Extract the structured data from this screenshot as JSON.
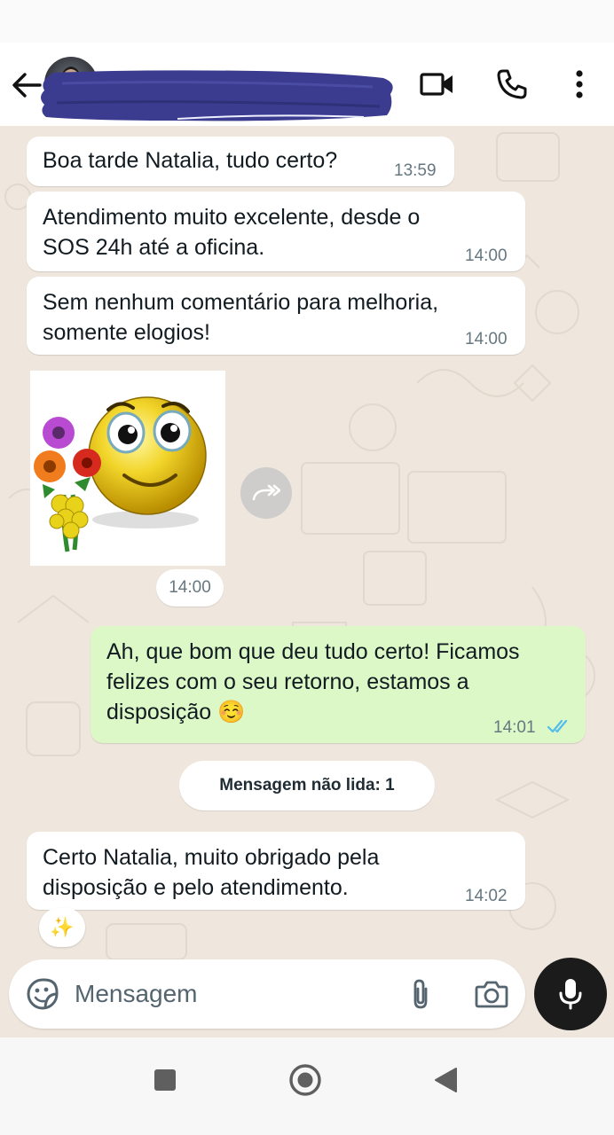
{
  "header": {
    "contact_name": "",
    "icons": {
      "back": "arrow-left-icon",
      "video": "video-call-icon",
      "voice": "phone-icon",
      "menu": "more-vertical-icon"
    }
  },
  "messages": [
    {
      "direction": "in",
      "text": "Boa tarde Natalia, tudo certo?",
      "time": "13:59"
    },
    {
      "direction": "in",
      "text_lines": [
        "Atendimento muito excelente, desde o",
        "SOS 24h até a oficina."
      ],
      "time": "14:00"
    },
    {
      "direction": "in",
      "text_lines": [
        "Sem nenhum comentário para melhoria,",
        "somente elogios!"
      ],
      "time": "14:00"
    },
    {
      "direction": "in",
      "type": "sticker",
      "sticker": "smiley-with-flowers-sticker",
      "time": "14:00"
    },
    {
      "direction": "out",
      "text_lines": [
        "Ah, que bom que deu tudo certo! Ficamos",
        "felizes com o seu retorno, estamos a",
        "disposição"
      ],
      "emoji": "☺️",
      "time": "14:01",
      "status": "read"
    },
    {
      "direction": "in",
      "text_lines": [
        "Certo Natalia, muito obrigado pela",
        "disposição e pelo atendimento."
      ],
      "time": "14:02",
      "reaction": "✨"
    }
  ],
  "unread_divider": "Mensagem não lida: 1",
  "composer": {
    "placeholder": "Mensagem",
    "value": ""
  },
  "colors": {
    "chat_background": "#efe7dd",
    "incoming_bubble": "#ffffff",
    "outgoing_bubble": "#dcf8c6",
    "read_ticks": "#53bdeb",
    "mic_button": "#1b1b1b",
    "redaction": "#3b3c8f"
  }
}
